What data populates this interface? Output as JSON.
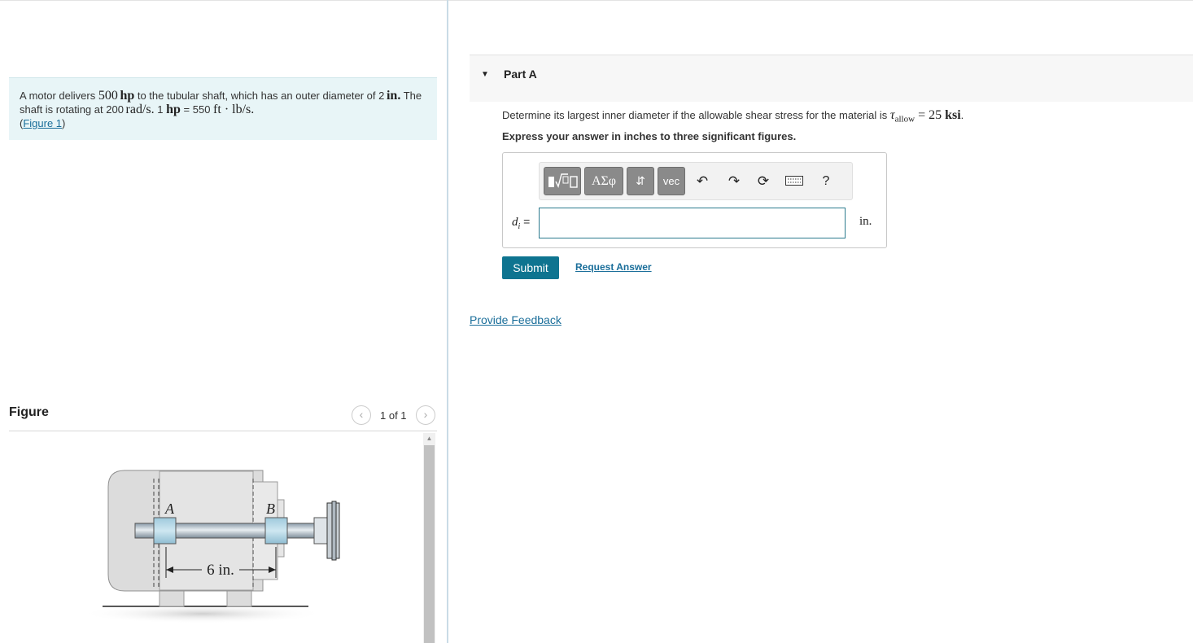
{
  "problem": {
    "text_1": "A motor delivers ",
    "power_value": "500",
    "power_unit": "hp",
    "text_2": " to the tubular shaft, which has an outer diameter of ",
    "diameter_value": "2",
    "diameter_unit": "in.",
    "text_3": " The shaft is rotating at ",
    "speed_value": "200",
    "speed_unit": "rad/s.",
    "conversion_1": " 1 ",
    "conversion_hp": "hp",
    "conversion_2": " = 550 ",
    "conversion_units": "ft · lb/s.",
    "figure_link_open": "(",
    "figure_link": "Figure 1",
    "figure_link_close": ")"
  },
  "figure_panel": {
    "title": "Figure",
    "prev_icon": "‹",
    "next_icon": "›",
    "counter": "1 of 1",
    "diagram": {
      "label_a": "A",
      "label_b": "B",
      "dimension": "6 in."
    }
  },
  "part_a": {
    "title": "Part A",
    "question_text": "Determine its largest inner diameter if the allowable shear stress for the material is ",
    "tau_symbol": "τ",
    "tau_subscript": "allow",
    "tau_equals": " = 25 ",
    "tau_unit": "ksi",
    "tau_end": ".",
    "instruction": "Express your answer in inches to three significant figures.",
    "toolbar": {
      "greek_label": "ΑΣφ",
      "arrows_label": "⇵",
      "vec_label": "vec",
      "help_label": "?"
    },
    "answer_symbol": "d",
    "answer_subscript": "i",
    "answer_equals": " =",
    "answer_value": "",
    "unit": "in.",
    "submit_label": "Submit",
    "request_answer_label": "Request Answer",
    "feedback_label": "Provide Feedback"
  },
  "colors": {
    "problem_bg": "#e8f5f7",
    "link": "#1a6e9a",
    "submit_bg": "#0e7490",
    "toolbar_button": "#8a8a8a"
  }
}
